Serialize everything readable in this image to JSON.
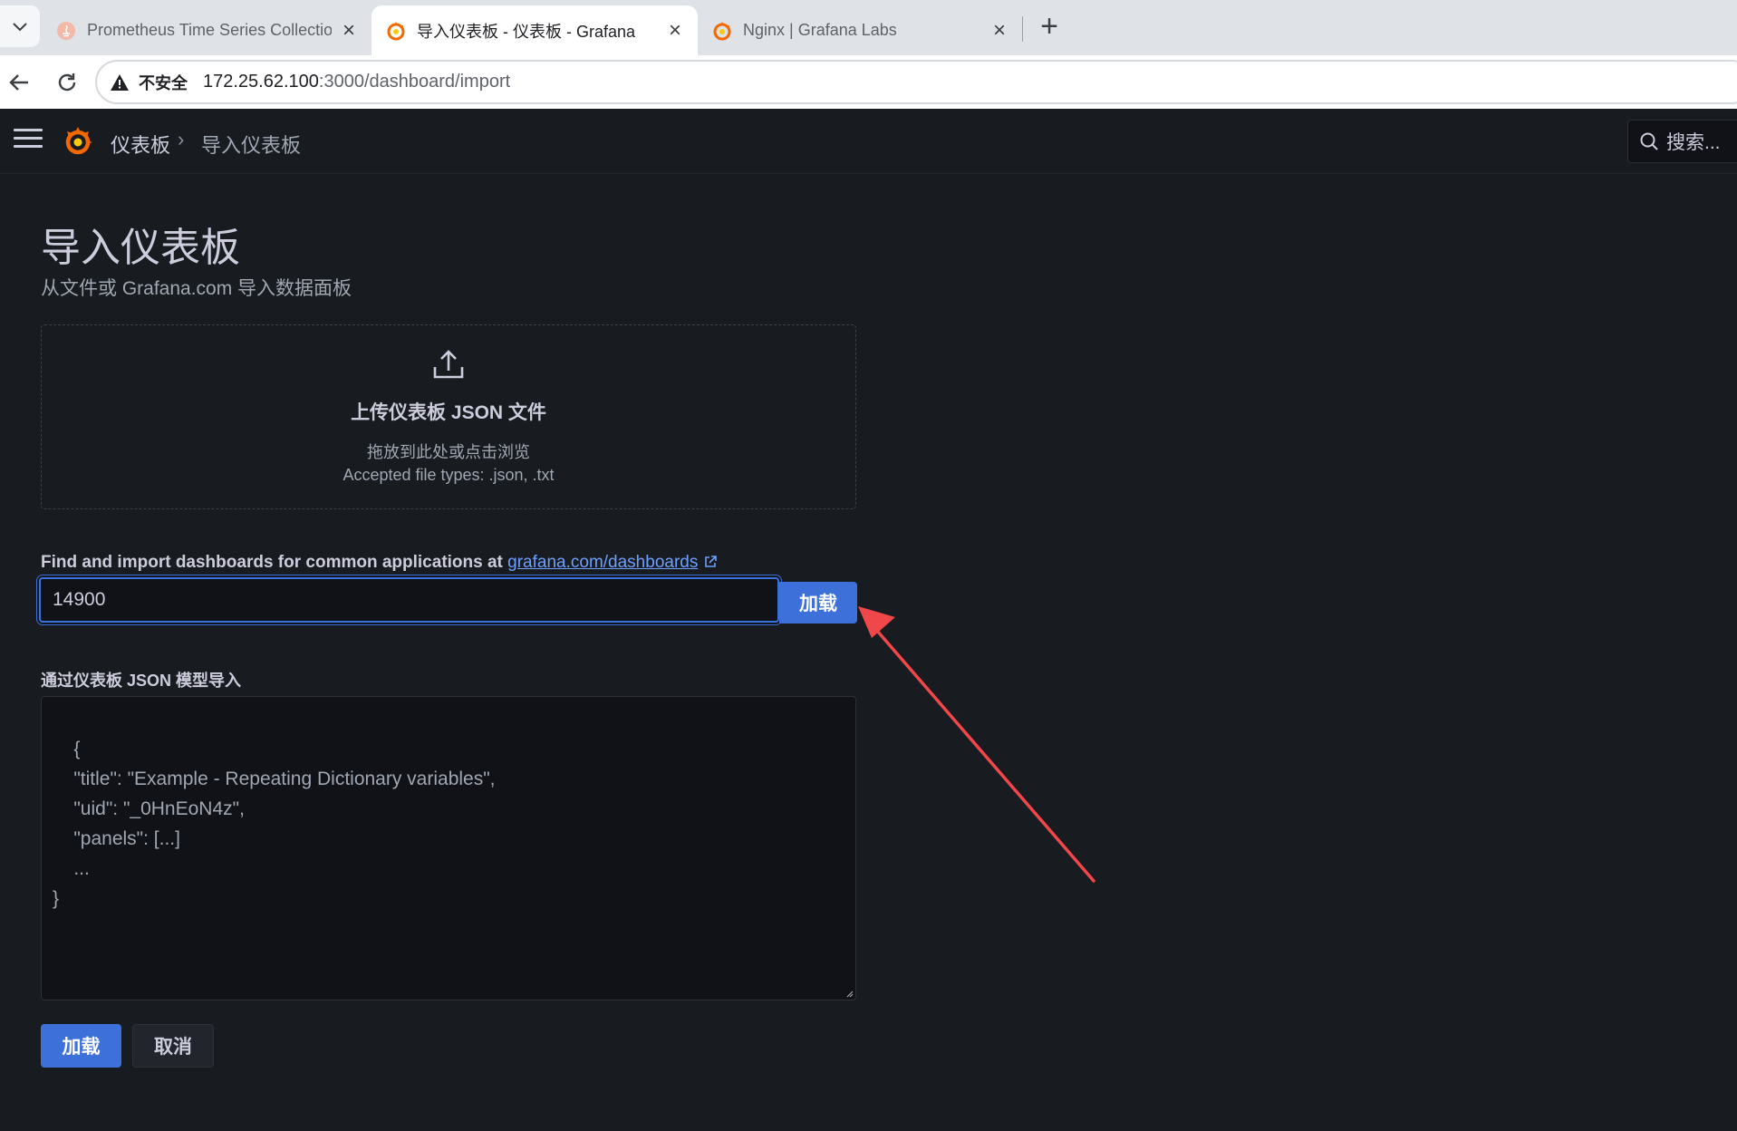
{
  "browser": {
    "tabs": [
      {
        "title": "Prometheus Time Series Collection",
        "favicon": "prometheus-icon",
        "active": false
      },
      {
        "title": "导入仪表板 - 仪表板 - Grafana",
        "favicon": "grafana-icon",
        "active": true
      },
      {
        "title": "Nginx | Grafana Labs",
        "favicon": "grafana-icon",
        "active": false
      }
    ],
    "address": {
      "security_label": "不安全",
      "host": "172.25.62.100",
      "path": ":3000/dashboard/import"
    }
  },
  "grafana": {
    "breadcrumb": {
      "root": "仪表板",
      "separator": "›",
      "current": "导入仪表板"
    },
    "search_placeholder": "搜索...",
    "page": {
      "title": "导入仪表板",
      "subtitle": "从文件或 Grafana.com 导入数据面板"
    },
    "upload": {
      "title": "上传仪表板 JSON 文件",
      "hint": "拖放到此处或点击浏览",
      "types": "Accepted file types: .json, .txt"
    },
    "find": {
      "label": "Find and import dashboards for common applications at ",
      "link": "grafana.com/dashboards",
      "input_value": "14900",
      "load_label": "加载"
    },
    "json_model": {
      "label": "通过仪表板 JSON 模型导入",
      "placeholder": "{\n    \"title\": \"Example - Repeating Dictionary variables\",\n    \"uid\": \"_0HnEoN4z\",\n    \"panels\": [...]\n    ...\n}"
    },
    "actions": {
      "load": "加载",
      "cancel": "取消"
    }
  },
  "colors": {
    "accent": "#3d71d9",
    "annotation_arrow": "#f0474b",
    "bg": "#181b1f"
  }
}
